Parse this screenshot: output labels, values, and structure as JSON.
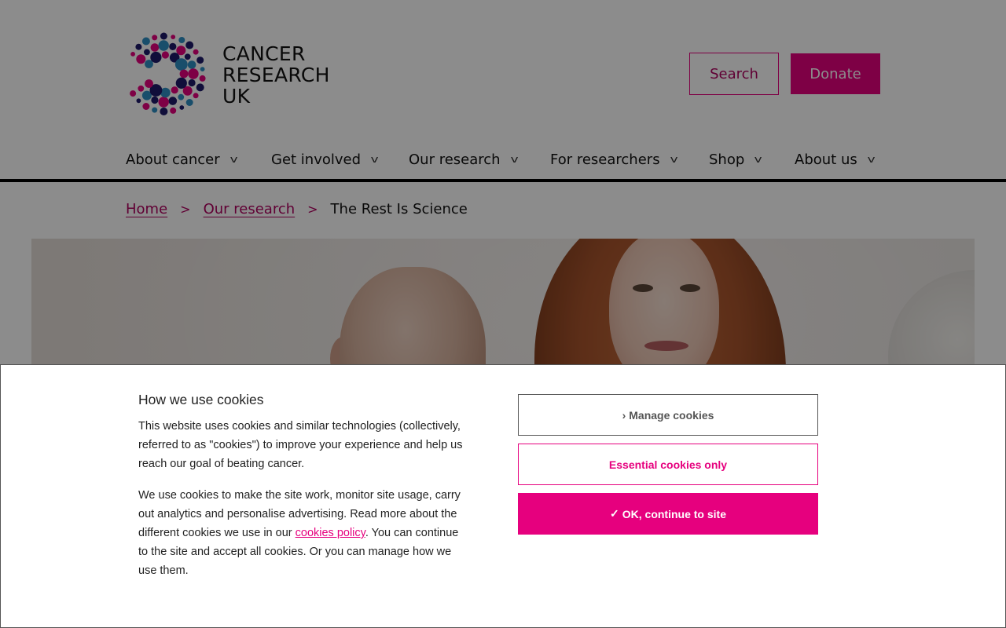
{
  "logo": {
    "line1": "CANCER",
    "line2": "RESEARCH",
    "line3": "UK"
  },
  "header": {
    "search_label": "Search",
    "donate_label": "Donate"
  },
  "nav": {
    "items": [
      {
        "label": "About cancer"
      },
      {
        "label": "Get involved"
      },
      {
        "label": "Our research"
      },
      {
        "label": "For researchers"
      },
      {
        "label": "Shop"
      },
      {
        "label": "About us"
      }
    ]
  },
  "breadcrumb": {
    "home": "Home",
    "our_research": "Our research",
    "current": "The Rest Is Science"
  },
  "cookie": {
    "title": "How we use cookies",
    "p1": "This website uses cookies and similar technologies (collectively, referred to as \"cookies\") to improve your experience and help us reach our goal of beating cancer.",
    "p2_before": "We use cookies to make the site work, monitor site usage, carry out analytics and personalise advertising. Read more about the different cookies we use in our ",
    "p2_link": "cookies policy",
    "p2_after": ". You can continue to the site and accept all cookies. Or you can manage how we use them.",
    "manage_prefix": "›",
    "manage_label": "Manage cookies",
    "essential_label": "Essential cookies only",
    "ok_prefix": "✓",
    "ok_label": "OK, continue to site"
  },
  "colors": {
    "brand_pink": "#e6007e",
    "brand_dark_pink": "#b0005f",
    "logo_navy": "#1e1a6b",
    "logo_blue": "#2f8fc4"
  },
  "icons": {
    "nav_chevron": "chevron-down-icon",
    "breadcrumb_separator": "chevron-right-icon"
  }
}
